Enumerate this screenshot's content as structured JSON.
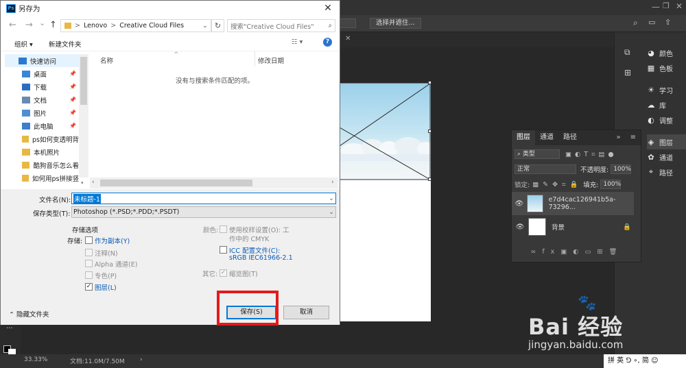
{
  "dialog": {
    "title": "另存为",
    "close_glyph": "✕",
    "nav": {
      "back": "←",
      "forward": "→",
      "dropdown": "⌄",
      "up": "↑"
    },
    "address": {
      "segments": [
        "Lenovo",
        "Creative Cloud Files"
      ],
      "sep": ">"
    },
    "refresh_glyph": "↻",
    "search_placeholder": "搜索\"Creative Cloud Files\"",
    "toolbar": {
      "organize": "组织 ▾",
      "new_folder": "新建文件夹",
      "view_glyph": "☷ ▾",
      "help": "?"
    },
    "tree": [
      {
        "label": "快速访问",
        "icon": "star-icon",
        "color": "#2a7ad2",
        "pinned": false,
        "top": true
      },
      {
        "label": "桌面",
        "icon": "desktop-icon",
        "color": "#3a86d6",
        "pinned": true
      },
      {
        "label": "下载",
        "icon": "download-icon",
        "color": "#2a6ec2",
        "pinned": true
      },
      {
        "label": "文档",
        "icon": "document-icon",
        "color": "#6c8ab0",
        "pinned": true
      },
      {
        "label": "图片",
        "icon": "picture-icon",
        "color": "#4f8fd0",
        "pinned": true
      },
      {
        "label": "此电脑",
        "icon": "computer-icon",
        "color": "#3d7fcc",
        "pinned": true
      },
      {
        "label": "ps如何变透明背",
        "icon": "folder-icon",
        "color": "#e8b844",
        "pinned": false
      },
      {
        "label": "本机照片",
        "icon": "folder-icon",
        "color": "#e8b844",
        "pinned": false
      },
      {
        "label": "酷狗音乐怎么看",
        "icon": "folder-icon",
        "color": "#e8b844",
        "pinned": false
      },
      {
        "label": "如何用ps拼接竖",
        "icon": "folder-icon",
        "color": "#e8b844",
        "pinned": false
      }
    ],
    "list": {
      "col_name": "名称",
      "col_date": "修改日期",
      "empty_message": "没有与搜索条件匹配的项。"
    },
    "filename_label": "文件名(N):",
    "filename_value": "未标题-1",
    "filetype_label": "保存类型(T):",
    "filetype_value": "Photoshop (*.PSD;*.PDD;*.PSDT)",
    "storage_heading": "存储选项",
    "storage_label": "存储:",
    "storage_options": [
      {
        "label": "作为副本(Y)",
        "checked": false,
        "enabled": true
      },
      {
        "label": "注释(N)",
        "checked": false,
        "enabled": false
      },
      {
        "label": "Alpha 通道(E)",
        "checked": false,
        "enabled": false
      },
      {
        "label": "专色(P)",
        "checked": false,
        "enabled": false
      },
      {
        "label": "图层(L)",
        "checked": true,
        "enabled": true
      }
    ],
    "color_label": "颜色:",
    "color_options": [
      {
        "line1": "使用校样设置(O):  工",
        "line2": "作中的 CMYK",
        "checked": false,
        "enabled": false
      },
      {
        "line1": "ICC 配置文件(C):",
        "line2": "sRGB IEC61966-2.1",
        "checked": false,
        "enabled": true
      }
    ],
    "other_label": "其它:",
    "thumbnail_option": {
      "label": "缩览图(T)",
      "checked": true,
      "enabled": false
    },
    "hide_folders": "隐藏文件夹",
    "save_button": "保存(S)",
    "cancel_button": "取消"
  },
  "photoshop": {
    "options_button": "选择并遮住...",
    "right_panel": [
      {
        "icon": "palette-icon",
        "glyph": "◕",
        "label": "颜色"
      },
      {
        "icon": "swatches-icon",
        "glyph": "▦",
        "label": "色板"
      },
      {
        "icon": "learn-icon",
        "glyph": "☀",
        "label": "学习"
      },
      {
        "icon": "library-icon",
        "glyph": "☁",
        "label": "库"
      },
      {
        "icon": "adjustments-icon",
        "glyph": "◐",
        "label": "调整"
      },
      {
        "icon": "layers-icon",
        "glyph": "◈",
        "label": "图层"
      },
      {
        "icon": "channels-icon",
        "glyph": "✿",
        "label": "通道"
      },
      {
        "icon": "paths-icon",
        "glyph": "⌖",
        "label": "路径"
      }
    ],
    "layers_panel": {
      "tabs": [
        "图层",
        "通道",
        "路径"
      ],
      "kind_placeholder": "类型",
      "blend_mode": "正常",
      "opacity_label": "不透明度:",
      "opacity_value": "100%",
      "lock_label": "锁定:",
      "fill_label": "填充:",
      "fill_value": "100%",
      "layers": [
        {
          "name": "e7d4cac126941b5a-73296...",
          "selected": true
        },
        {
          "name": "背景",
          "selected": false,
          "locked": true
        }
      ]
    },
    "zoom": "33.33%",
    "doc_info": "文档:11.0M/7.50M",
    "ime": "拼 英 ⅁ ∘, 简 ☺",
    "watermark_text": "Bai 经验",
    "watermark_url": "jingyan.baidu.com"
  },
  "colors": {
    "accent": "#0078d7",
    "highlight": "#e31b1b",
    "ps_dark": "#282828"
  }
}
